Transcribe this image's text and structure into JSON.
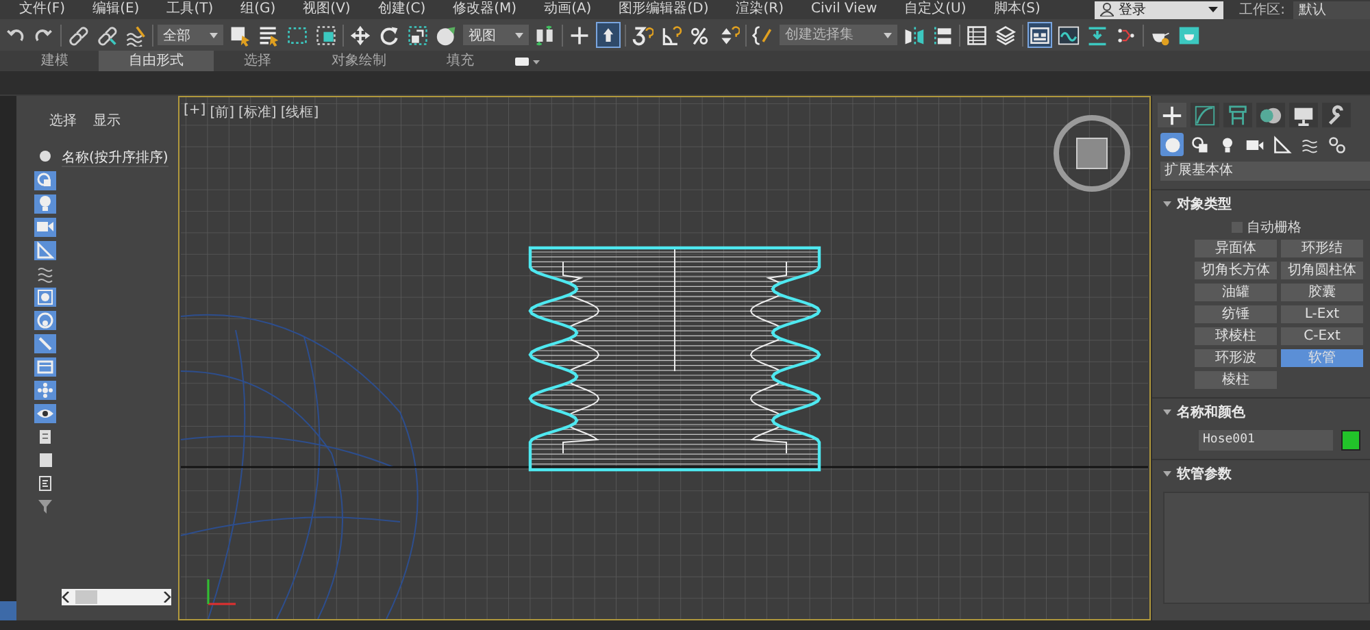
{
  "menu_bar": {
    "items": [
      "文件(F)",
      "编辑(E)",
      "工具(T)",
      "组(G)",
      "视图(V)",
      "创建(C)",
      "修改器(M)",
      "动画(A)",
      "图形编辑器(D)",
      "渲染(R)",
      "Civil View",
      "自定义(U)",
      "脚本(S)"
    ],
    "login": "登录",
    "workspace_label": "工作区:",
    "workspace_value": "默认"
  },
  "toolbar": {
    "tools": [
      {
        "kind": "undo",
        "selected": false
      },
      {
        "kind": "redo",
        "selected": false
      },
      {
        "kind": "separator"
      },
      {
        "kind": "link",
        "selected": false
      },
      {
        "kind": "unlink",
        "selected": false
      },
      {
        "kind": "bind",
        "selected": false
      },
      {
        "kind": "separator"
      },
      {
        "kind": "filter-dropdown",
        "value": "全部"
      },
      {
        "kind": "select",
        "selected": false
      },
      {
        "kind": "select-by-name",
        "selected": false
      },
      {
        "kind": "region",
        "selected": false
      },
      {
        "kind": "crossing",
        "selected": false
      },
      {
        "kind": "separator"
      },
      {
        "kind": "move",
        "selected": false
      },
      {
        "kind": "rotate",
        "selected": false
      },
      {
        "kind": "scale",
        "selected": false
      },
      {
        "kind": "place",
        "selected": false
      },
      {
        "kind": "coordinate-dropdown",
        "value": "视图"
      },
      {
        "kind": "pivot",
        "selected": false
      },
      {
        "kind": "separator"
      },
      {
        "kind": "cross",
        "selected": false
      },
      {
        "kind": "pin",
        "selected": true
      },
      {
        "kind": "separator"
      },
      {
        "kind": "snap",
        "selected": false
      },
      {
        "kind": "angle-snap",
        "selected": false
      },
      {
        "kind": "percent-snap",
        "selected": false
      },
      {
        "kind": "spinner-snap",
        "selected": false
      },
      {
        "kind": "separator"
      },
      {
        "kind": "named-sets",
        "selected": false
      },
      {
        "kind": "selection-set-dropdown",
        "placeholder": "创建选择集"
      },
      {
        "kind": "mirror",
        "selected": false
      },
      {
        "kind": "align",
        "selected": false
      },
      {
        "kind": "separator"
      },
      {
        "kind": "list",
        "selected": false
      },
      {
        "kind": "layers",
        "selected": false
      },
      {
        "kind": "separator"
      },
      {
        "kind": "panel",
        "selected": true
      },
      {
        "kind": "curve",
        "selected": false
      },
      {
        "kind": "download",
        "selected": false
      },
      {
        "kind": "nodes",
        "selected": false
      },
      {
        "kind": "separator"
      },
      {
        "kind": "teapot-gear",
        "selected": false
      },
      {
        "kind": "teapot-window",
        "selected": false
      }
    ]
  },
  "ribbon": {
    "tabs": [
      {
        "label": "建模",
        "selected": false
      },
      {
        "label": "自由形式",
        "selected": true
      },
      {
        "label": "选择",
        "selected": false
      },
      {
        "label": "对象绘制",
        "selected": false
      },
      {
        "label": "填充",
        "selected": false
      }
    ]
  },
  "scene_explorer": {
    "tabs": [
      "选择",
      "显示"
    ],
    "column_header": "名称(按升序排序)",
    "filters": [
      {
        "on": true
      },
      {
        "on": true
      },
      {
        "on": true
      },
      {
        "on": true
      },
      {
        "on": false
      },
      {
        "on": true
      },
      {
        "on": true
      },
      {
        "on": true
      },
      {
        "on": true
      },
      {
        "on": true
      },
      {
        "on": true
      },
      {
        "on": false
      },
      {
        "on": false
      },
      {
        "on": false
      },
      {
        "on": false
      }
    ]
  },
  "viewport": {
    "labels": [
      "[+]",
      "[前]",
      "[标准]",
      "[线框]"
    ]
  },
  "command_panel": {
    "tabs": [
      {
        "selected": true
      },
      {
        "selected": false
      },
      {
        "selected": false
      },
      {
        "selected": false
      },
      {
        "selected": false
      },
      {
        "selected": false
      }
    ],
    "subcategories": [
      {
        "selected": true
      },
      {
        "selected": false
      },
      {
        "selected": false
      },
      {
        "selected": false
      },
      {
        "selected": false
      },
      {
        "selected": false
      },
      {
        "selected": false
      }
    ],
    "category": "扩展基本体",
    "object_type": {
      "title": "对象类型",
      "autogrid": {
        "label": "自动栅格",
        "checked": false
      },
      "buttons": [
        {
          "label": "异面体",
          "selected": false
        },
        {
          "label": "环形结",
          "selected": false
        },
        {
          "label": "切角长方体",
          "selected": false
        },
        {
          "label": "切角圆柱体",
          "selected": false
        },
        {
          "label": "油罐",
          "selected": false
        },
        {
          "label": "胶囊",
          "selected": false
        },
        {
          "label": "纺锤",
          "selected": false
        },
        {
          "label": "L-Ext",
          "selected": false
        },
        {
          "label": "球棱柱",
          "selected": false
        },
        {
          "label": "C-Ext",
          "selected": false
        },
        {
          "label": "环形波",
          "selected": false
        },
        {
          "label": "软管",
          "selected": true
        },
        {
          "label": "棱柱",
          "selected": false
        }
      ]
    },
    "name_and_color": {
      "title": "名称和颜色",
      "name": "Hose001",
      "color": "#22c32a"
    },
    "hose_parameters": {
      "title": "软管参数"
    }
  }
}
